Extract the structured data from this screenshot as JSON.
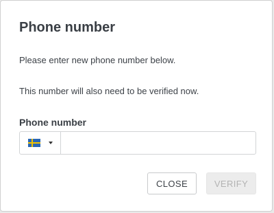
{
  "dialog": {
    "title": "Phone number",
    "instruction": "Please enter new phone number below.",
    "verification_note": "This number will also need to be verified now.",
    "field_label": "Phone number",
    "country_select": {
      "flag_icon": "sweden-flag-icon",
      "colors": {
        "blue": "#2a67b5",
        "yellow": "#f4c400"
      }
    },
    "phone_input": {
      "value": "",
      "placeholder": ""
    },
    "close_label": "CLOSE",
    "verify_label": "VERIFY",
    "verify_disabled": true
  }
}
